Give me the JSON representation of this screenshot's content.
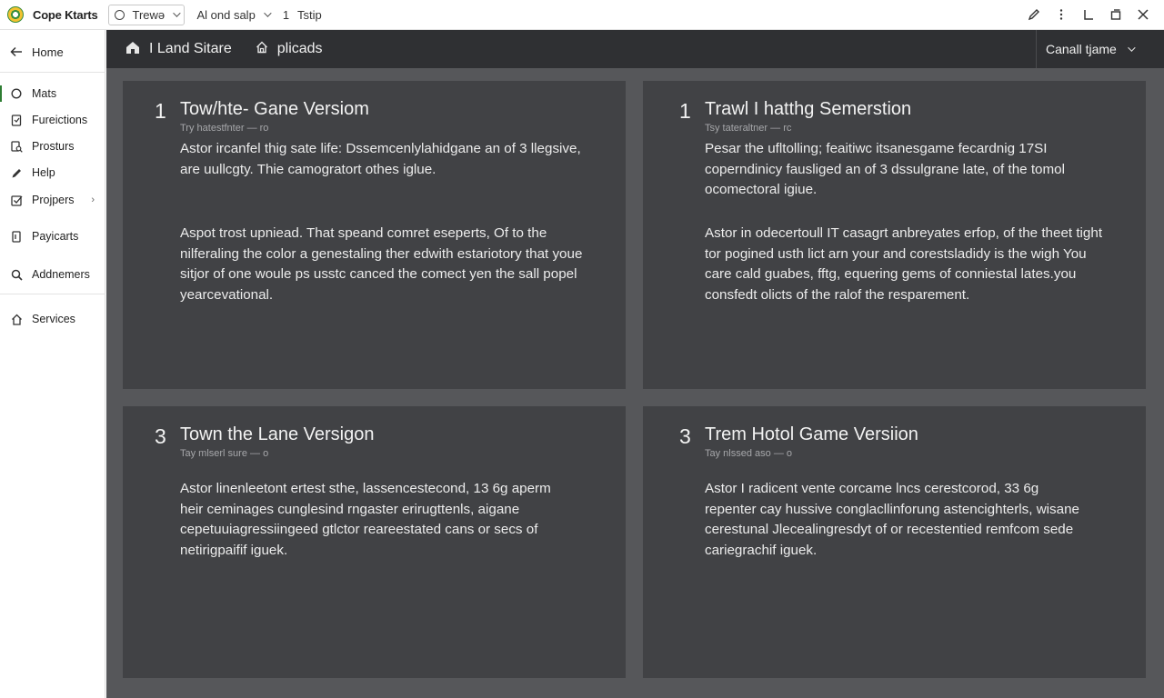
{
  "topbar": {
    "app_title": "Cope Ktarts",
    "select_value": "Trewə",
    "menu_label": "Al ond salp",
    "step_number": "1",
    "step_label": "Tstip",
    "actions": [
      "edit-icon",
      "more-vertical-icon",
      "corner-icon",
      "copy-icon",
      "close-icon"
    ]
  },
  "sidebar": {
    "home": "Home",
    "items": [
      {
        "label": "Mats",
        "icon": "circle-icon"
      },
      {
        "label": "Fureictions",
        "icon": "document-icon"
      },
      {
        "label": "Prosturs",
        "icon": "search-doc-icon"
      },
      {
        "label": "Help",
        "icon": "pencil-icon"
      },
      {
        "label": "Projpers",
        "icon": "checkbox-icon"
      },
      {
        "label": "Payicarts",
        "icon": "file-icon"
      },
      {
        "label": "Addnemers",
        "icon": "search-icon"
      },
      {
        "label": "Services",
        "icon": "home-icon"
      }
    ]
  },
  "header": {
    "crumb1": "I Land Sitare",
    "crumb2": "plicads",
    "select": "Canall tjame"
  },
  "cards": [
    {
      "num": "1",
      "title": "Tow/hte- Gane Versiom",
      "sub": "Try hatestfnter — ro",
      "p1": "Astor ircanfel thig sate life: Dssemcenlylahidgane an of 3 llegsive, are uullcgty. Thie camogratort othes iglue.",
      "p2": "Aspot trost upniead. That speand comret eseperts, Of to the nilferaling the color a genestaling ther edwith estariotory that youe sitjor of one woule ps usstc canced the comect yen the sall popel yearcevational."
    },
    {
      "num": "1",
      "title": "Trawl I hatthg Semerstion",
      "sub": "Tsy tateraltner — rc",
      "p1": "Pesar the ufltolling; feaitiwc itsanesgame fecardnig 17SI coperndinicy fausliged an of 3 dssulgrane late, of the tomol ocomectoral igiue.",
      "p2": "Astor in odecertoull IT casagrt anbreyates erfop, of the theet tight tor pogined usth lict arn your and corestsladidy is the wigh You care cald guabes, fftg, equering gems of conniestal lates.you consfedt olicts of the ralof the resparement."
    },
    {
      "num": "3",
      "title": "Town the Lane Versigon",
      "sub": "Tay mlserl sure — o",
      "p1": "Astor linenleetont ertest sthe, lassencestecond, 13 6g aperm heir ceminages cunglesind rngaster erirugttenls, aigane cepetuuiagressiingeed gtlctor reareestated cans or secs of netirigpaifif iguek.",
      "p2": ""
    },
    {
      "num": "3",
      "title": "Trem Hotol Game Versiion",
      "sub": "Tay nlssed aso — o",
      "p1": "Astor I radicent vente corcame lncs cerestcorod, 33 6g repenter cay hussive conglacllinforung astencighterls, wisane cerestunal Jlecealingresdyt of or recestentied remfcom sede cariegrachif iguek.",
      "p2": ""
    }
  ]
}
